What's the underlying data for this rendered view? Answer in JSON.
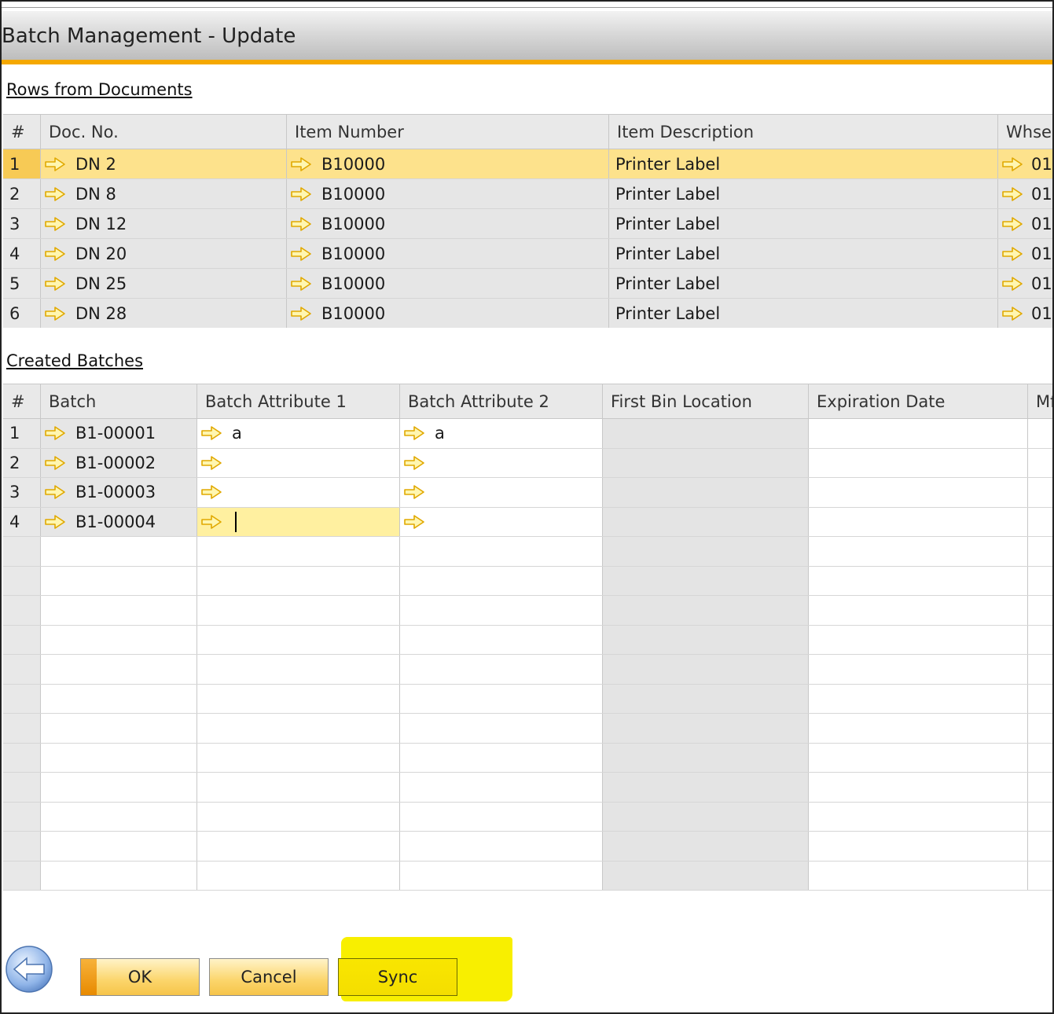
{
  "window": {
    "title": "Batch Management - Update"
  },
  "rows_section": {
    "title": "Rows from Documents",
    "columns": [
      "#",
      "Doc. No.",
      "Item Number",
      "Item Description",
      "Whse"
    ],
    "rows": [
      {
        "num": "1",
        "doc": "DN 2",
        "item": "B10000",
        "desc": "Printer Label",
        "whse": "01"
      },
      {
        "num": "2",
        "doc": "DN 8",
        "item": "B10000",
        "desc": "Printer Label",
        "whse": "01"
      },
      {
        "num": "3",
        "doc": "DN 12",
        "item": "B10000",
        "desc": "Printer Label",
        "whse": "01"
      },
      {
        "num": "4",
        "doc": "DN 20",
        "item": "B10000",
        "desc": "Printer Label",
        "whse": "01"
      },
      {
        "num": "5",
        "doc": "DN 25",
        "item": "B10000",
        "desc": "Printer Label",
        "whse": "01"
      },
      {
        "num": "6",
        "doc": "DN 28",
        "item": "B10000",
        "desc": "Printer Label",
        "whse": "01"
      }
    ]
  },
  "batches_section": {
    "title": "Created Batches",
    "columns": [
      "#",
      "Batch",
      "Batch Attribute 1",
      "Batch Attribute 2",
      "First Bin Location",
      "Expiration Date",
      "Mf"
    ],
    "rows": [
      {
        "num": "1",
        "batch": "B1-00001",
        "attr1": "a",
        "attr2": "a"
      },
      {
        "num": "2",
        "batch": "B1-00002",
        "attr1": "",
        "attr2": ""
      },
      {
        "num": "3",
        "batch": "B1-00003",
        "attr1": "",
        "attr2": ""
      },
      {
        "num": "4",
        "batch": "B1-00004",
        "attr1": "",
        "attr2": ""
      }
    ]
  },
  "buttons": {
    "ok": "OK",
    "cancel": "Cancel",
    "sync": "Sync"
  },
  "icons": {
    "link_arrow": "link-arrow-icon",
    "back": "back-arrow-icon"
  },
  "colors": {
    "accent": "#f5a800",
    "selected_row": "#fde28c",
    "highlight": "#f8ef00"
  }
}
